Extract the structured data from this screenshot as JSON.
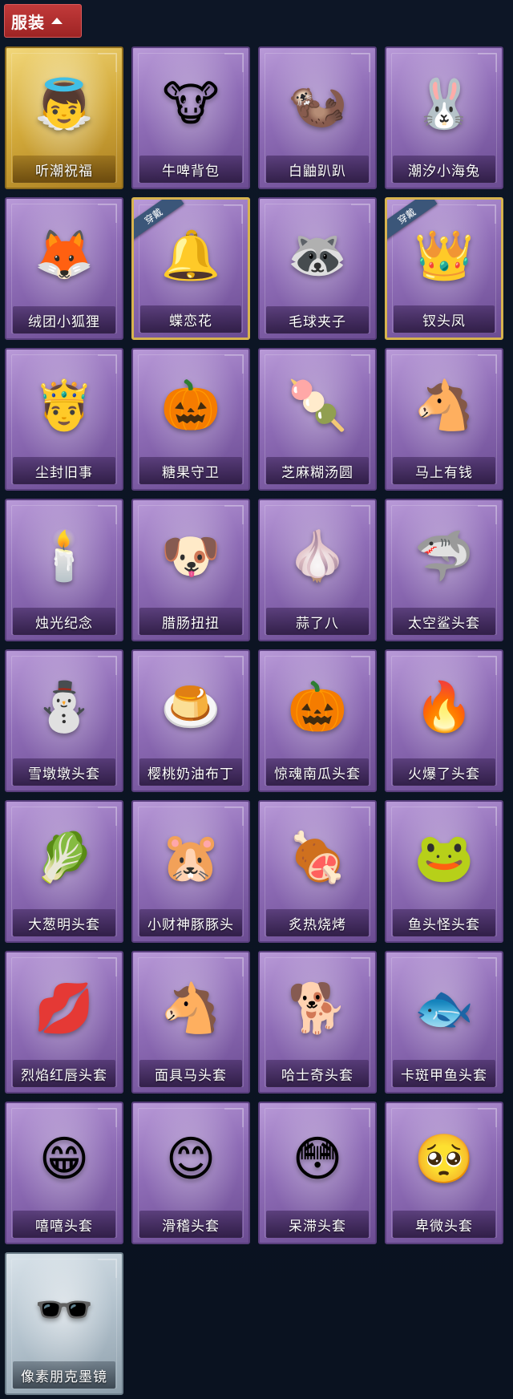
{
  "header": {
    "title": "服装",
    "icon": "chevron-up-icon",
    "color": "#b32d2d"
  },
  "items": [
    {
      "name": "听潮祝福",
      "icon": "👼",
      "rarity": "gold"
    },
    {
      "name": "牛啤背包",
      "icon": "🐮",
      "rarity": "purple"
    },
    {
      "name": "白鼬趴趴",
      "icon": "🦦",
      "rarity": "purple"
    },
    {
      "name": "潮汐小海兔",
      "icon": "🐰",
      "rarity": "purple"
    },
    {
      "name": "绒团小狐狸",
      "icon": "🦊",
      "rarity": "purple"
    },
    {
      "name": "蝶恋花",
      "icon": "🔔",
      "rarity": "purple",
      "badge": "穿戴"
    },
    {
      "name": "毛球夹子",
      "icon": "🦝",
      "rarity": "purple"
    },
    {
      "name": "钗头凤",
      "icon": "👑",
      "rarity": "purple",
      "badge": "穿戴"
    },
    {
      "name": "尘封旧事",
      "icon": "🤴",
      "rarity": "purple"
    },
    {
      "name": "糖果守卫",
      "icon": "🎃",
      "rarity": "purple"
    },
    {
      "name": "芝麻糊汤圆",
      "icon": "🍡",
      "rarity": "purple"
    },
    {
      "name": "马上有钱",
      "icon": "🐴",
      "rarity": "purple"
    },
    {
      "name": "烛光纪念",
      "icon": "🕯️",
      "rarity": "purple"
    },
    {
      "name": "腊肠扭扭",
      "icon": "🐶",
      "rarity": "purple"
    },
    {
      "name": "蒜了八",
      "icon": "🧄",
      "rarity": "purple"
    },
    {
      "name": "太空鲨头套",
      "icon": "🦈",
      "rarity": "purple"
    },
    {
      "name": "雪墩墩头套",
      "icon": "⛄",
      "rarity": "purple"
    },
    {
      "name": "樱桃奶油布丁",
      "icon": "🍮",
      "rarity": "purple"
    },
    {
      "name": "惊魂南瓜头套",
      "icon": "🎃",
      "rarity": "purple"
    },
    {
      "name": "火爆了头套",
      "icon": "🔥",
      "rarity": "purple"
    },
    {
      "name": "大葱明头套",
      "icon": "🥬",
      "rarity": "purple"
    },
    {
      "name": "小财神豚豚头",
      "icon": "🐹",
      "rarity": "purple"
    },
    {
      "name": "炙热烧烤",
      "icon": "🍖",
      "rarity": "purple"
    },
    {
      "name": "鱼头怪头套",
      "icon": "🐸",
      "rarity": "purple"
    },
    {
      "name": "烈焰红唇头套",
      "icon": "💋",
      "rarity": "purple"
    },
    {
      "name": "面具马头套",
      "icon": "🐴",
      "rarity": "purple"
    },
    {
      "name": "哈士奇头套",
      "icon": "🐕",
      "rarity": "purple"
    },
    {
      "name": "卡斑甲鱼头套",
      "icon": "🐟",
      "rarity": "purple"
    },
    {
      "name": "嘻嘻头套",
      "icon": "😁",
      "rarity": "purple"
    },
    {
      "name": "滑稽头套",
      "icon": "😊",
      "rarity": "purple"
    },
    {
      "name": "呆滞头套",
      "icon": "😳",
      "rarity": "purple"
    },
    {
      "name": "卑微头套",
      "icon": "🥺",
      "rarity": "purple"
    },
    {
      "name": "像素朋克墨镜",
      "icon": "🕶️",
      "rarity": "grey"
    }
  ]
}
